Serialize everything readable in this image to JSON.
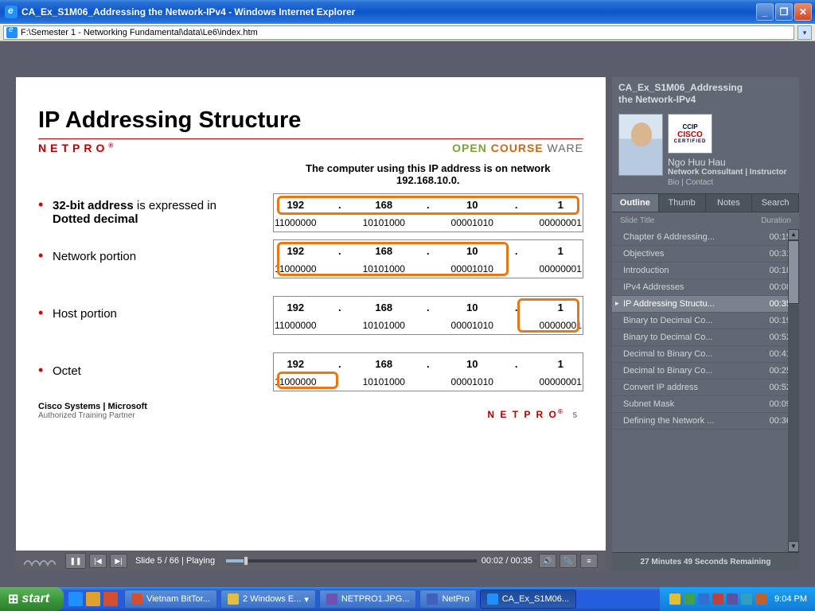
{
  "window": {
    "title": "CA_Ex_S1M06_Addressing the Network-IPv4 - Windows Internet Explorer",
    "address": "F:\\Semester 1 - Networking Fundamental\\data\\Le6\\index.htm"
  },
  "slide": {
    "title": "IP Addressing Structure",
    "brand": "NETPRO",
    "ocw_open": "OPEN",
    "ocw_course": "COURSE",
    "ocw_ware": "WARE",
    "caption_l1": "The computer using this IP address is on network",
    "caption_l2": "192.168.10.0.",
    "bullets": {
      "b1_bold1": "32-bit address",
      "b1_mid": " is expressed in ",
      "b1_bold2": "Dotted decimal",
      "b2": "Network portion",
      "b3": "Host portion",
      "b4": "Octet"
    },
    "ip": {
      "o1": "192",
      "o2": "168",
      "o3": "10",
      "o4": "1",
      "dot": "."
    },
    "bin": {
      "o1": "11000000",
      "o2": "10101000",
      "o3": "00001010",
      "o4": "00000001"
    },
    "foot_brand": "Cisco Systems | Microsoft",
    "foot_sub": "Authorized Training Partner",
    "foot_netpro": "N E T P R O",
    "page_num": "5"
  },
  "player": {
    "pos": "Slide 5 / 66 | Playing",
    "time": "00:02 / 00:35"
  },
  "sidebar": {
    "title_l1": "CA_Ex_S1M06_Addressing",
    "title_l2": "the Network-IPv4",
    "author_name": "Ngo Huu Hau",
    "author_role": "Network Consultant | Instructor",
    "author_links": "Bio  |   Contact",
    "cert_l1": "CCIP",
    "cert_l2": "CISCO",
    "cert_l3": "CERTIFIED",
    "tabs": [
      "Outline",
      "Thumb",
      "Notes",
      "Search"
    ],
    "head_title": "Slide Title",
    "head_dur": "Duration",
    "items": [
      {
        "label": "Chapter 6 Addressing...",
        "dur": "00:15"
      },
      {
        "label": "Objectives",
        "dur": "00:31"
      },
      {
        "label": "Introduction",
        "dur": "00:18"
      },
      {
        "label": "IPv4 Addresses",
        "dur": "00:08"
      },
      {
        "label": "IP Addressing Structu...",
        "dur": "00:35"
      },
      {
        "label": "Binary to Decimal Co...",
        "dur": "00:19"
      },
      {
        "label": "Binary to Decimal Co...",
        "dur": "00:52"
      },
      {
        "label": "Decimal to Binary Co...",
        "dur": "00:41"
      },
      {
        "label": "Decimal to Binary Co...",
        "dur": "00:25"
      },
      {
        "label": "Convert IP address",
        "dur": "00:52"
      },
      {
        "label": "Subnet Mask",
        "dur": "00:09"
      },
      {
        "label": "Defining the Network ...",
        "dur": "00:36"
      }
    ],
    "remaining": "27 Minutes 49 Seconds Remaining"
  },
  "taskbar": {
    "start": "start",
    "items": [
      "Vietnam BitTor...",
      "2 Windows E...",
      "NETPRO1.JPG...",
      "NetPro",
      "CA_Ex_S1M06..."
    ],
    "clock": "9:04 PM"
  }
}
